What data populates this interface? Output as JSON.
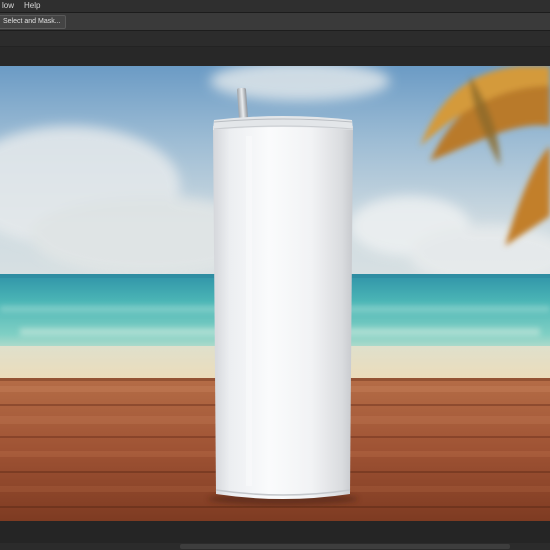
{
  "menubar": {
    "items": [
      "low",
      "Help"
    ]
  },
  "options_bar": {
    "select_and_mask_label": "Select and Mask..."
  },
  "colors": {
    "ui_dark": "#2f2f2f",
    "sky_top": "#6c9cc4",
    "sea": "#4fb7b6",
    "sand": "#e8dcc0",
    "wood": "#a2573a",
    "tumbler": "#f1f2f4"
  }
}
